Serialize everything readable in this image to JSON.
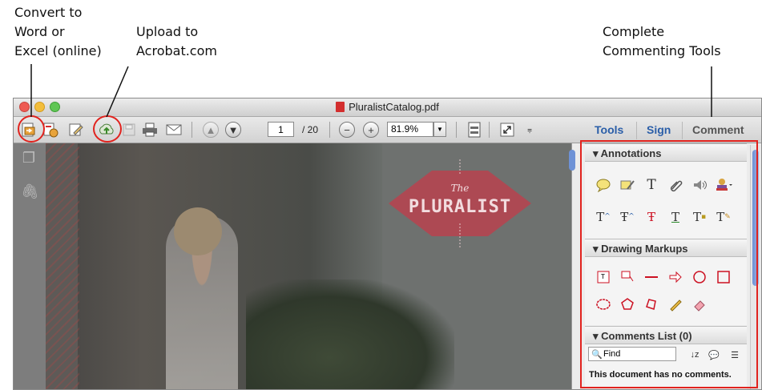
{
  "callouts": {
    "convert": [
      "Convert to",
      "Word or",
      "Excel (online)"
    ],
    "upload": [
      "Upload to",
      "Acrobat.com"
    ],
    "commenting": [
      "Complete",
      "Commenting Tools"
    ]
  },
  "window": {
    "title": "PluralistCatalog.pdf"
  },
  "toolbar": {
    "page_current": "1",
    "page_total": "/ 20",
    "zoom": "81.9%",
    "tabs": [
      "Tools",
      "Sign",
      "Comment"
    ]
  },
  "document": {
    "badge_small": "The",
    "badge_large": "PLURALIST"
  },
  "panel": {
    "annotations_title": "Annotations",
    "drawing_title": "Drawing Markups",
    "comments_title": "Comments List (0)",
    "find_placeholder": "Find",
    "no_comments": "This document has no comments."
  },
  "colors": {
    "highlight": "#e1231e",
    "tab_active": "#2a5ea8",
    "badge": "#b8424f"
  },
  "icons": {
    "annotations_row1": [
      "sticky-note-icon",
      "highlight-text-icon",
      "add-text-icon",
      "attach-file-icon",
      "record-audio-icon",
      "stamp-icon"
    ],
    "annotations_row2": [
      "insert-text-icon",
      "replace-text-icon",
      "strikethrough-icon",
      "underline-icon",
      "add-note-to-text-icon",
      "text-correction-icon"
    ],
    "drawing_row1": [
      "text-box-icon",
      "callout-icon",
      "line-icon",
      "arrow-icon",
      "oval-icon",
      "rectangle-icon"
    ],
    "drawing_row2": [
      "cloud-icon",
      "polygon-icon",
      "connected-lines-icon",
      "pencil-icon",
      "eraser-icon"
    ]
  }
}
